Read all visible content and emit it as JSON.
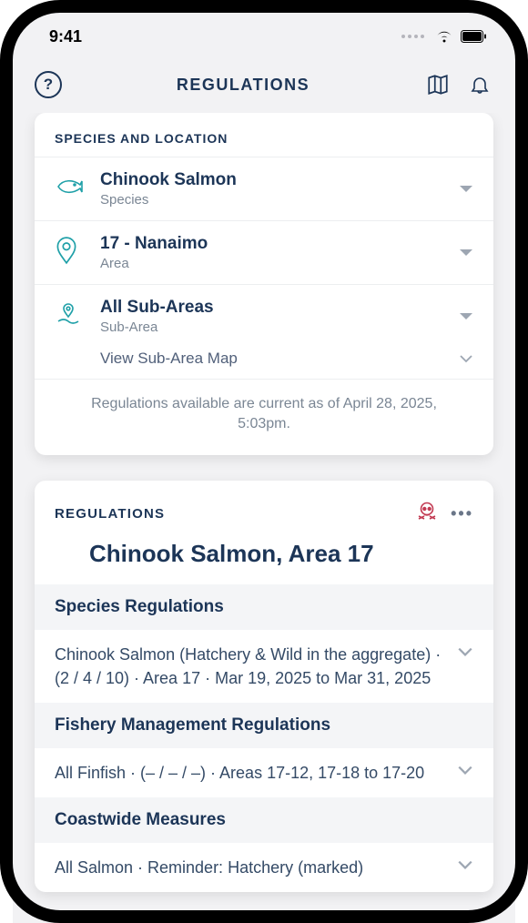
{
  "status": {
    "time": "9:41"
  },
  "header": {
    "title": "REGULATIONS"
  },
  "selectors": {
    "heading": "SPECIES AND LOCATION",
    "species": {
      "value": "Chinook Salmon",
      "label": "Species"
    },
    "area": {
      "value": "17 - Nanaimo",
      "label": "Area"
    },
    "subarea": {
      "value": "All Sub-Areas",
      "label": "Sub-Area",
      "mapLink": "View Sub-Area Map"
    },
    "disclaimer": "Regulations available are current as of April 28, 2025, 5:03pm."
  },
  "regulations": {
    "heading": "REGULATIONS",
    "title": "Chinook Salmon, Area 17",
    "sections": [
      {
        "name": "Species Regulations",
        "item": "Chinook Salmon (Hatchery & Wild in the aggregate)  ·  (2 / 4 / 10)  ·  Area 17  ·  Mar 19, 2025 to Mar 31, 2025"
      },
      {
        "name": "Fishery Management Regulations",
        "item": "All Finfish  ·  (– / – / –)  ·  Areas 17-12, 17-18 to 17-20"
      },
      {
        "name": "Coastwide Measures",
        "item": "All Salmon  ·  Reminder: Hatchery (marked)"
      }
    ]
  }
}
